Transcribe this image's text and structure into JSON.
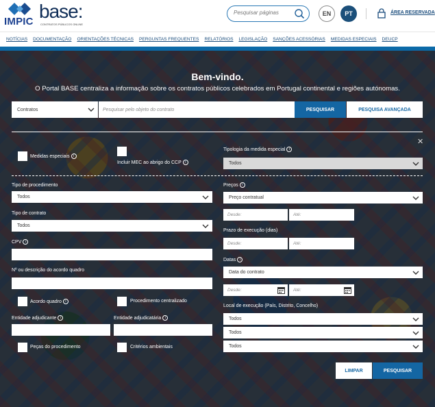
{
  "header": {
    "logo_impic": "IMPIC",
    "logo_base": "base:",
    "logo_base_sub": "CONTRATOS PÚBLICOS ONLINE",
    "search_placeholder": "Pesquisar páginas",
    "lang_en": "EN",
    "lang_pt": "PT",
    "area_reservada": "ÁREA RESERVADA"
  },
  "nav": {
    "items": [
      "NOTÍCIAS",
      "DOCUMENTAÇÃO",
      "ORIENTAÇÕES TÉCNICAS",
      "PERGUNTAS FREQUENTES",
      "RELATÓRIOS",
      "LEGISLAÇÃO",
      "SANÇÕES ACESSÓRIAS",
      "MEDIDAS ESPECIAIS",
      "DEUCP"
    ]
  },
  "hero": {
    "title": "Bem-vindo.",
    "intro": "O Portal BASE centraliza a informação sobre os contratos públicos celebrados em Portugal continental e regiões autónomas."
  },
  "search": {
    "type_value": "Contratos",
    "object_placeholder": "Pesquisar pelo objeto do contrato",
    "search_button": "PESQUISAR",
    "advanced_button": "PESQUISA AVANÇADA"
  },
  "filters": {
    "medidas_especiais": "Medidas especiais",
    "incluir_mec": "Incluir MEC ao abrigo do CCP",
    "tipologia_label": "Tipologia da medida especial",
    "tipologia_value": "Todos",
    "tipo_procedimento_label": "Tipo de procedimento",
    "tipo_procedimento_value": "Todos",
    "tipo_contrato_label": "Tipo de contrato",
    "tipo_contrato_value": "Todos",
    "cpv_label": "CPV",
    "acordo_label": "Nº ou descrição do acordo quadro",
    "acordo_quadro": "Acordo quadro",
    "procedimento_centralizado": "Procedimento centralizado",
    "entidade_adjudicante": "Entidade adjudicante",
    "entidade_adjudicataria": "Entidade adjudicatária",
    "pecas": "Peças do procedimento",
    "criterios": "Critérios ambientais",
    "precos_label": "Preços",
    "precos_value": "Preço contratual",
    "desde": "Desde:",
    "ate": "Até:",
    "prazo_label": "Prazo de execução (dias)",
    "datas_label": "Datas",
    "datas_value": "Data do contrato",
    "local_label": "Local de execução (País, Distrito, Concelho)",
    "local_values": [
      "Todos",
      "Todos",
      "Todos"
    ],
    "clear_button": "LIMPAR",
    "search_button": "PESQUISAR"
  }
}
